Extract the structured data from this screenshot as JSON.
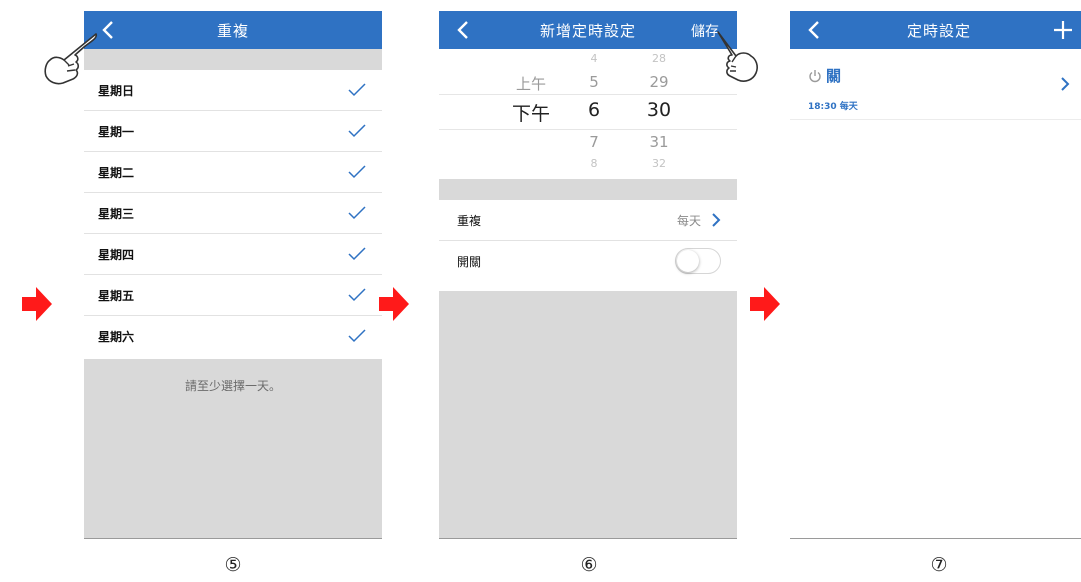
{
  "screen5": {
    "title": "重複",
    "days": [
      {
        "label": "星期日",
        "checked": true
      },
      {
        "label": "星期一",
        "checked": true
      },
      {
        "label": "星期二",
        "checked": true
      },
      {
        "label": "星期三",
        "checked": true
      },
      {
        "label": "星期四",
        "checked": true
      },
      {
        "label": "星期五",
        "checked": true
      },
      {
        "label": "星期六",
        "checked": true
      }
    ],
    "hint": "請至少選擇一天。",
    "step": "⑤"
  },
  "screen6": {
    "title": "新增定時設定",
    "save_label": "儲存",
    "picker": {
      "ampm": [
        "上午",
        "下午"
      ],
      "hours": [
        "4",
        "5",
        "6",
        "7",
        "8"
      ],
      "minutes": [
        "28",
        "29",
        "30",
        "31",
        "32"
      ],
      "selected": {
        "ampm": "下午",
        "hour": "6",
        "minute": "30"
      }
    },
    "repeat_label": "重複",
    "repeat_value": "每天",
    "switch_label": "開關",
    "switch_on": false,
    "step": "⑥"
  },
  "screen7": {
    "title": "定時設定",
    "item": {
      "state": "關",
      "time": "18:30",
      "repeat": "每天"
    },
    "step": "⑦"
  },
  "colors": {
    "header": "#2f72c3",
    "accent": "#2f72c3",
    "arrow": "#ff1a1a",
    "gray": "#d9d9d9"
  }
}
